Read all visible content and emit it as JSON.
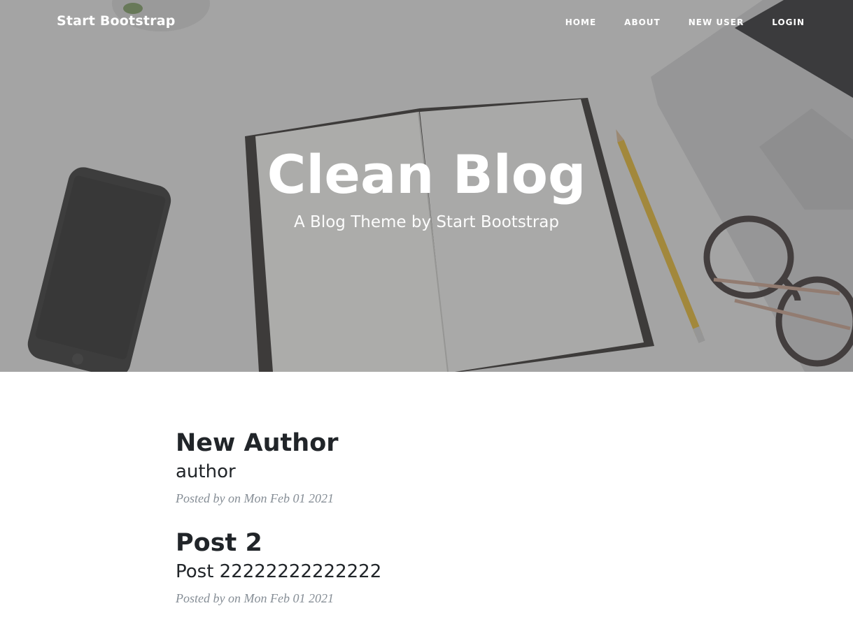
{
  "navbar": {
    "brand": "Start Bootstrap",
    "links": [
      {
        "label": "HOME"
      },
      {
        "label": "ABOUT"
      },
      {
        "label": "NEW USER"
      },
      {
        "label": "LOGIN"
      }
    ]
  },
  "hero": {
    "title": "Clean Blog",
    "subtitle": "A Blog Theme by Start Bootstrap",
    "background_image": "desk-with-notebook-phone-pencil-glasses-laptop"
  },
  "posts": [
    {
      "title": "New Author",
      "subtitle": "author",
      "meta": "Posted by on Mon Feb 01 2021"
    },
    {
      "title": "Post 2",
      "subtitle": "Post 22222222222222",
      "meta": "Posted by on Mon Feb 01 2021"
    }
  ],
  "colors": {
    "heading_text": "#212529",
    "meta_text": "#868e96",
    "hero_overlay": "#505050"
  }
}
